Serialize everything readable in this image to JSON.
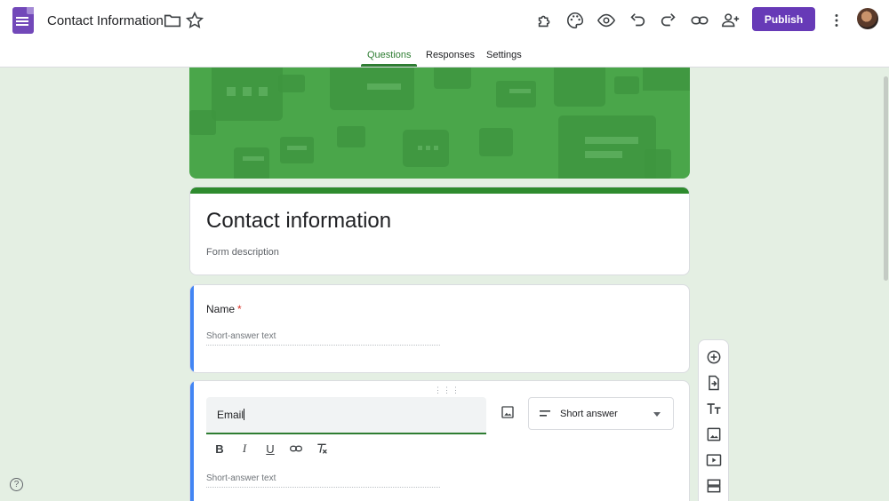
{
  "header": {
    "doc_title": "Contact Information",
    "publish_label": "Publish",
    "icons": [
      "folder-icon",
      "star-icon",
      "addons-icon",
      "palette-icon",
      "preview-icon",
      "undo-icon",
      "redo-icon",
      "link-icon",
      "add-collaborator-icon",
      "more-vert-icon"
    ]
  },
  "tabs": [
    {
      "label": "Questions",
      "active": true
    },
    {
      "label": "Responses",
      "active": false
    },
    {
      "label": "Settings",
      "active": false
    }
  ],
  "form": {
    "title": "Contact information",
    "description": "Form description"
  },
  "questions": [
    {
      "title": "Name",
      "required_mark": "*",
      "answer_placeholder": "Short-answer text"
    },
    {
      "title": "Email",
      "type": "Short answer",
      "answer_placeholder": "Short-answer text"
    }
  ],
  "format_toolbar": [
    "B",
    "I",
    "U"
  ],
  "side_toolbar": [
    "add-question-icon",
    "import-questions-icon",
    "add-title-icon",
    "add-image-icon",
    "add-video-icon",
    "add-section-icon"
  ],
  "colors": {
    "accent": "#673ab7",
    "theme": "#4aa64a",
    "active_tab": "#2e7d32",
    "focus_bar": "#4285f4"
  },
  "help_label": "?"
}
